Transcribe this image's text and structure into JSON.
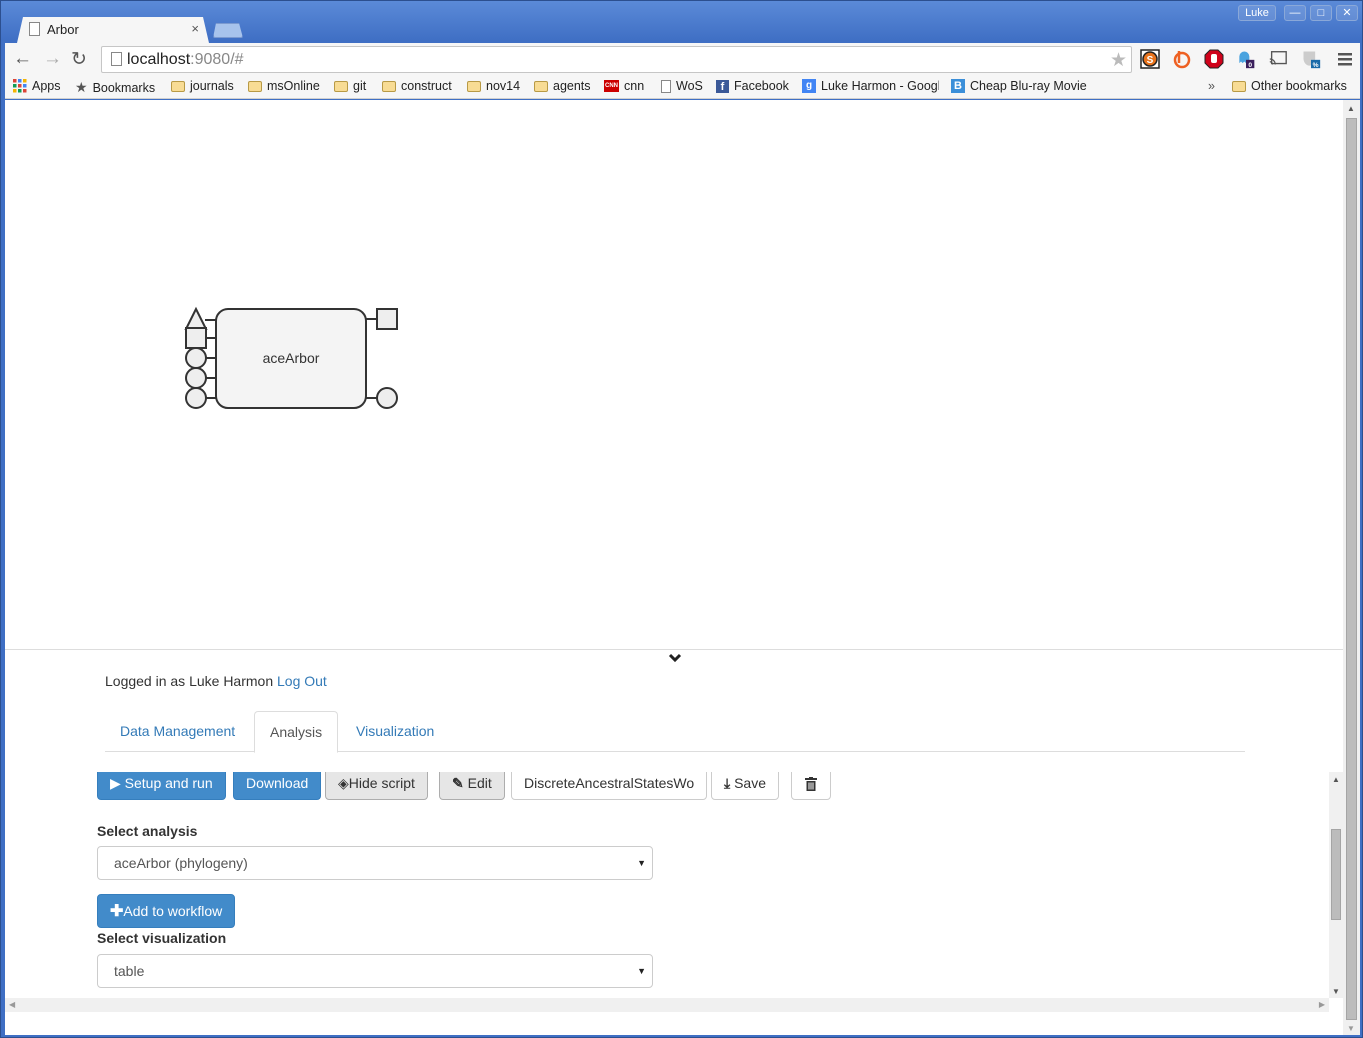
{
  "browser": {
    "tab_title": "Arbor",
    "tab_close": "×",
    "profile": "Luke",
    "window_buttons": {
      "minimize": "—",
      "maximize": "□",
      "close": "✕"
    },
    "nav": {
      "back": "←",
      "forward": "→",
      "reload": "↻"
    },
    "url_host": "localhost",
    "url_rest": ":9080/#",
    "star": "★",
    "extensions": [
      {
        "name": "s-extension-icon",
        "color": "#e8731c"
      },
      {
        "name": "bitly-icon",
        "color": "#ee6123"
      },
      {
        "name": "adblock-icon",
        "color": "#d0021b"
      },
      {
        "name": "ghostery-icon",
        "color": "#4aa3df",
        "badge": "0"
      },
      {
        "name": "cast-icon",
        "color": "#555555"
      },
      {
        "name": "shield-icon",
        "color": "#aaaaaa",
        "badge": "%"
      },
      {
        "name": "menu-icon",
        "color": "#555555"
      }
    ],
    "bookmarks": [
      {
        "label": "Apps",
        "icon": "apps"
      },
      {
        "label": "Bookmarks",
        "icon": "star"
      },
      {
        "label": "journals",
        "icon": "folder"
      },
      {
        "label": "msOnline",
        "icon": "folder"
      },
      {
        "label": "git",
        "icon": "folder"
      },
      {
        "label": "construct",
        "icon": "folder"
      },
      {
        "label": "nov14",
        "icon": "folder"
      },
      {
        "label": "agents",
        "icon": "folder"
      },
      {
        "label": "cnn",
        "icon": "cnn"
      },
      {
        "label": "WoS",
        "icon": "page"
      },
      {
        "label": "Facebook",
        "icon": "facebook"
      },
      {
        "label": "Luke Harmon - Googl",
        "icon": "scholar"
      },
      {
        "label": "Cheap Blu-ray Movie",
        "icon": "b"
      }
    ],
    "bookmarks_overflow": "»",
    "other_bookmarks": "Other bookmarks"
  },
  "workflow": {
    "node_label": "aceArbor"
  },
  "app": {
    "collapse_chevron": "⌄",
    "login_prefix": "Logged in as Luke Harmon",
    "logout": "Log Out",
    "tabs": [
      {
        "label": "Data Management",
        "active": false
      },
      {
        "label": "Analysis",
        "active": true
      },
      {
        "label": "Visualization",
        "active": false
      }
    ],
    "toolbar": {
      "setup_run": "Setup and run",
      "download": "Download",
      "hide_script": "Hide script",
      "edit": "Edit",
      "workflow_name": "DiscreteAncestralStatesWo",
      "save": "Save"
    },
    "select_analysis_label": "Select analysis",
    "select_analysis_value": "aceArbor (phylogeny)",
    "add_to_workflow": "Add to workflow",
    "select_visualization_label": "Select visualization",
    "select_visualization_value": "table"
  },
  "colors": {
    "primary": "#428bca",
    "link": "#337ab7",
    "chrome_frame": "#3f6fc4"
  }
}
